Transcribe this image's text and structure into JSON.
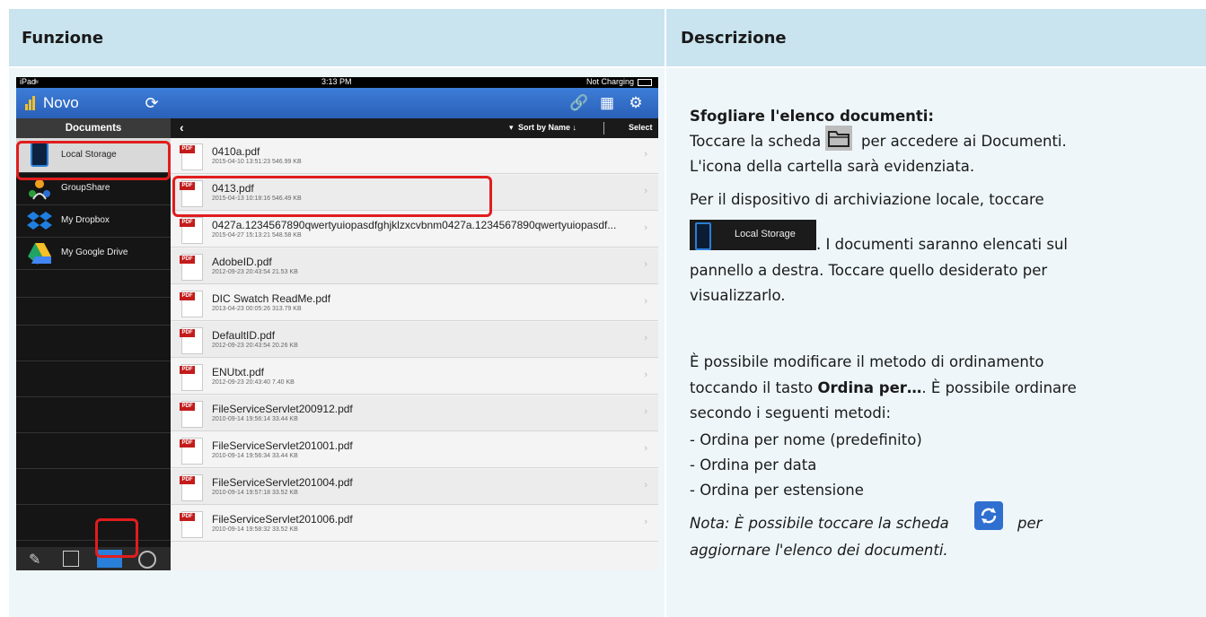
{
  "table": {
    "header_left": "Funzione",
    "header_right": "Descrizione"
  },
  "ipad": {
    "status": {
      "device": "iPad",
      "time": "3:13 PM",
      "battery": "Not Charging"
    },
    "app_name": "Novo",
    "sidebar_title": "Documents",
    "sidebar_items": [
      {
        "label": "Local Storage",
        "icon": "tablet-icon"
      },
      {
        "label": "GroupShare",
        "icon": "groupshare-icon"
      },
      {
        "label": "My Dropbox",
        "icon": "dropbox-icon"
      },
      {
        "label": "My Google Drive",
        "icon": "google-drive-icon"
      }
    ],
    "sort_label": "Sort by Name ↓",
    "select_label": "Select",
    "files": [
      {
        "name": "0410a.pdf",
        "meta": "2015-04-10 13:51:23   546.99 KB"
      },
      {
        "name": "0413.pdf",
        "meta": "2015-04-13 10:18:16   546.49 KB"
      },
      {
        "name": "0427a.1234567890qwertyuiopasdfghjklzxcvbnm0427a.1234567890qwertyuiopasdf...",
        "meta": "2015-04-27 15:13:21   548.58 KB"
      },
      {
        "name": "AdobeID.pdf",
        "meta": "2012-09-23 20:43:54   21.53 KB"
      },
      {
        "name": "DIC Swatch ReadMe.pdf",
        "meta": "2013-04-23 00:05:26   313.79 KB"
      },
      {
        "name": "DefaultID.pdf",
        "meta": "2012-09-23 20:43:54   20.26 KB"
      },
      {
        "name": "ENUtxt.pdf",
        "meta": "2012-09-23 20:43:40   7.40 KB"
      },
      {
        "name": "FileServiceServlet200912.pdf",
        "meta": "2010-09-14 19:56:14   33.44 KB"
      },
      {
        "name": "FileServiceServlet201001.pdf",
        "meta": "2010-09-14 19:56:34   33.44 KB"
      },
      {
        "name": "FileServiceServlet201004.pdf",
        "meta": "2010-09-14 19:57:18   33.52 KB"
      },
      {
        "name": "FileServiceServlet201006.pdf",
        "meta": "2010-09-14 19:58:32   33.52 KB"
      }
    ],
    "pdf_badge": "PDF",
    "accent_color": "#2f6fd0",
    "highlight_color": "#e11d1d"
  },
  "description": {
    "heading": "Sfogliare l'elenco documenti:",
    "l1a": "Toccare la scheda",
    "l1b": "per accedere ai Documenti.",
    "l2": "L'icona della cartella sarà evidenziata.",
    "l3": "Per il dispositivo di archiviazione locale, toccare",
    "chip_label": "Local Storage",
    "l4": ". I documenti saranno elencati sul",
    "l5": "pannello a destra. Toccare quello desiderato per",
    "l6": "visualizzarlo.",
    "l7": "È possibile modificare il metodo di ordinamento",
    "l8a": "toccando il tasto ",
    "l8b": "Ordina per…",
    "l8c": ". È possibile ordinare",
    "l9": "secondo i seguenti metodi:",
    "bullets": [
      "-   Ordina per nome (predefinito)",
      "-   Ordina per data",
      "-   Ordina per estensione"
    ],
    "note_a": "Nota: È possibile toccare la scheda",
    "note_b": "per",
    "note_c": "aggiornare l'elenco dei documenti."
  }
}
